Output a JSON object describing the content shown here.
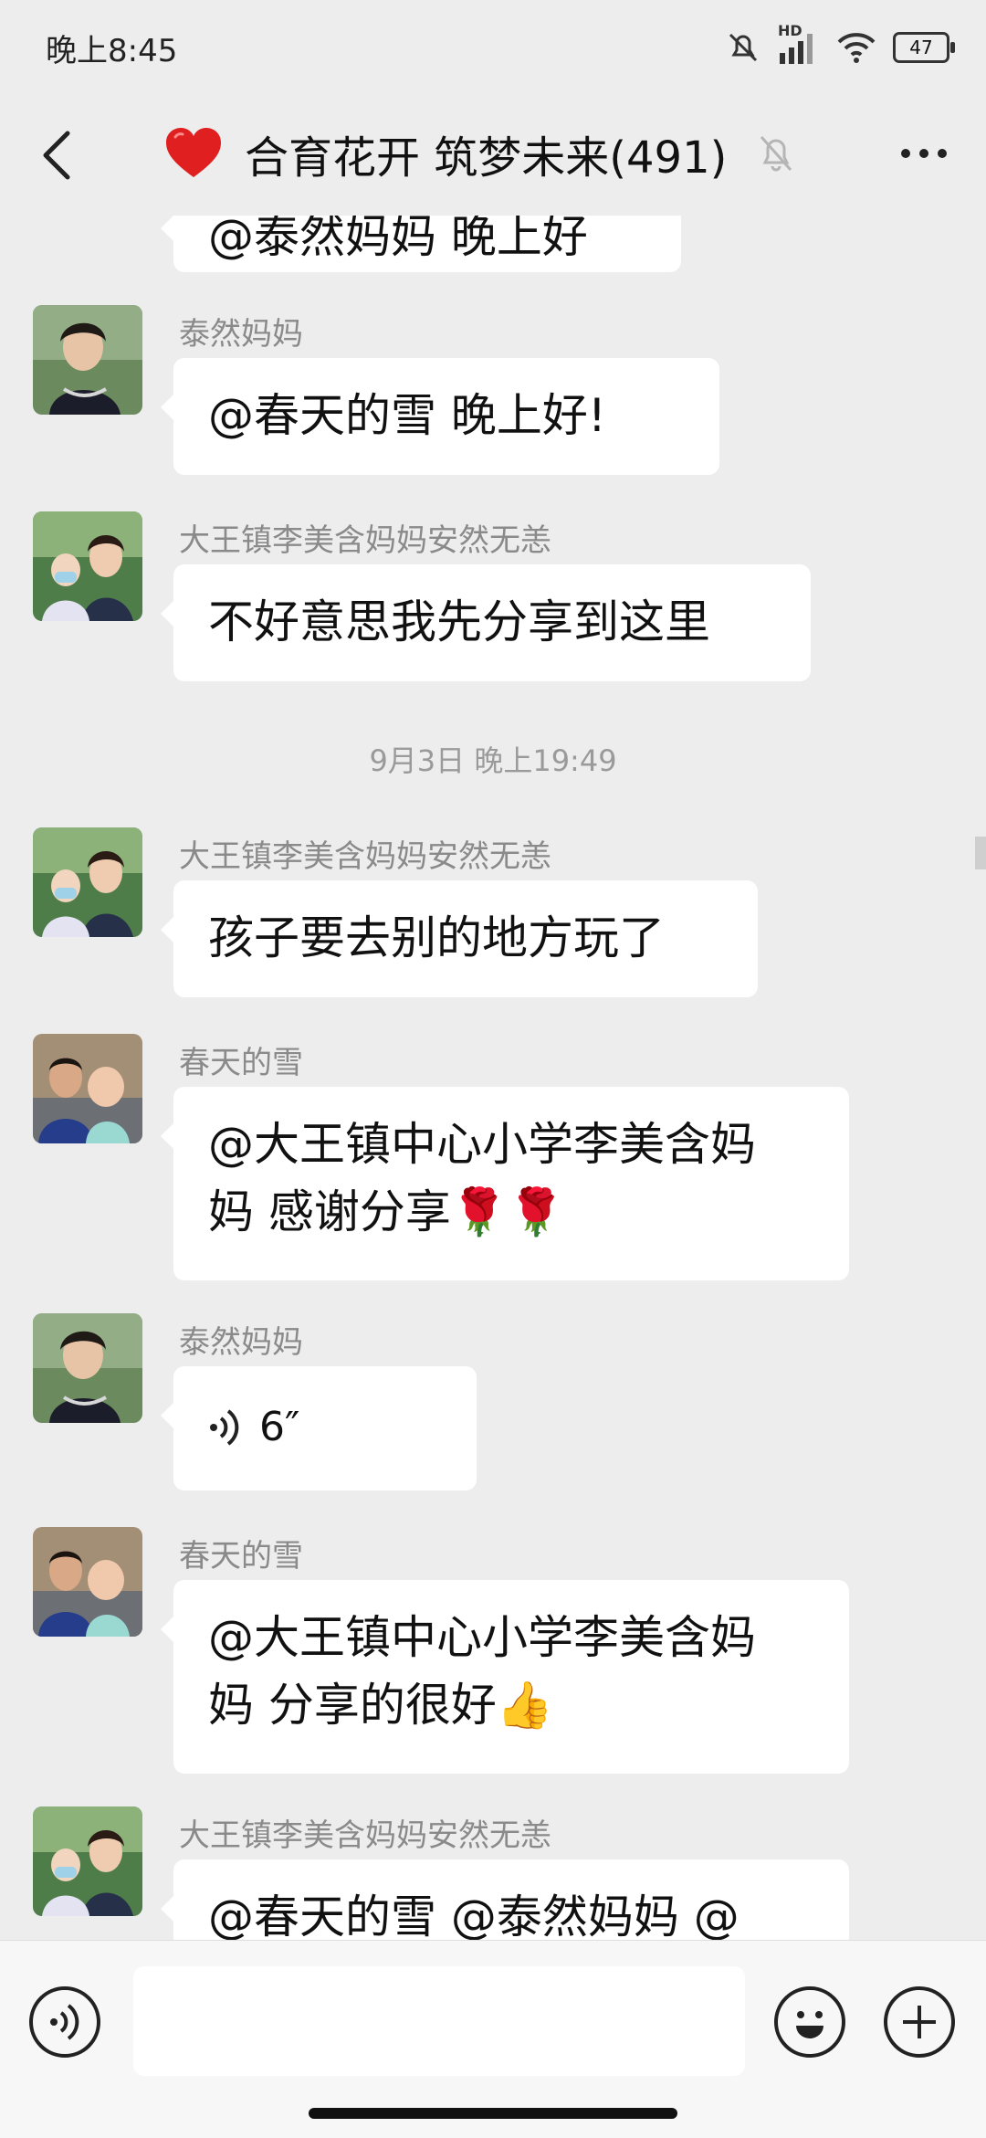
{
  "status": {
    "time": "晚上8:45",
    "network_label": "HD",
    "battery": "47"
  },
  "header": {
    "title": "合育花开 筑梦未来(491)"
  },
  "messages": [
    {
      "text": "@泰然妈妈  晚上好"
    },
    {
      "sender": "泰然妈妈",
      "text": "@春天的雪  晚上好!"
    },
    {
      "sender": "大王镇李美含妈妈安然无恙",
      "text": "不好意思我先分享到这里"
    },
    {
      "timestamp": "9月3日 晚上19:49"
    },
    {
      "sender": "大王镇李美含妈妈安然无恙",
      "text": "孩子要去别的地方玩了"
    },
    {
      "sender": "春天的雪",
      "line1": "@大王镇中心小学李美含妈",
      "line2": "妈  感谢分享🌹🌹"
    },
    {
      "sender": "泰然妈妈",
      "voice_duration": "6″"
    },
    {
      "sender": "春天的雪",
      "line1": "@大王镇中心小学李美含妈",
      "line2": "妈  分享的很好👍"
    },
    {
      "sender": "大王镇李美含妈妈安然无恙",
      "text": "@春天的雪  @泰然妈妈  @"
    }
  ],
  "input": {
    "value": "",
    "placeholder": ""
  },
  "colors": {
    "background": "#ededed",
    "bubble": "#ffffff",
    "heart": "#e02020"
  }
}
